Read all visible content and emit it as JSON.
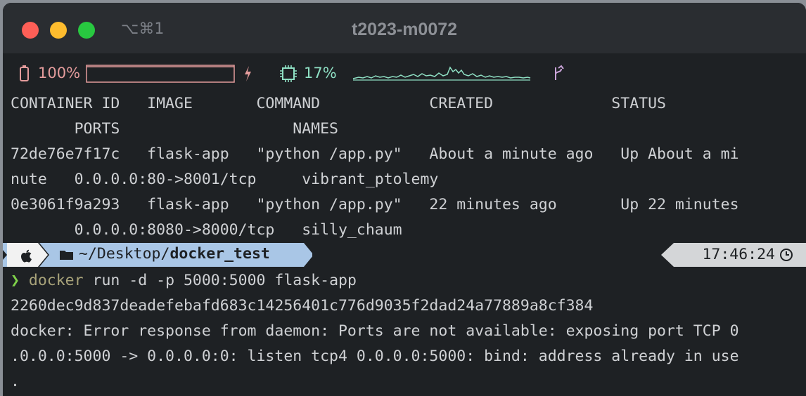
{
  "window": {
    "shortcut": "⌥⌘1",
    "title": "t2023-m0072"
  },
  "status_bar": {
    "battery_pct": "100%",
    "battery_level": 1.0,
    "cpu_pct": "17%"
  },
  "docker_ps": {
    "header_line1": "CONTAINER ID   IMAGE       COMMAND            CREATED             STATUS",
    "header_line2": "       PORTS                   NAMES",
    "rows": [
      "72de76e7f17c   flask-app   \"python /app.py\"   About a minute ago   Up About a mi",
      "nute   0.0.0.0:80->8001/tcp     vibrant_ptolemy",
      "0e3061f9a293   flask-app   \"python /app.py\"   22 minutes ago       Up 22 minutes",
      "       0.0.0.0:8080->8000/tcp   silly_chaum"
    ]
  },
  "prompt": {
    "path_prefix": "~/Desktop/",
    "path_dir": "docker_test",
    "time": "17:46:24",
    "symbol": "❯",
    "command_name": "docker",
    "command_args": " run -d -p 5000:5000 flask-app"
  },
  "output": {
    "container_hash": "2260dec9d837deadefebafd683c14256401c776d9035f2dad24a77889a8cf384",
    "error_lines": [
      "docker: Error response from daemon: Ports are not available: exposing port TCP 0",
      ".0.0.0:5000 -> 0.0.0.0:0: listen tcp4 0.0.0.0:5000: bind: address already in use",
      "."
    ]
  },
  "colors": {
    "segment_blue": "#a9c6e6",
    "time_segment": "#d4d6d8",
    "battery": "#e49c9c",
    "cpu": "#8fe0c4",
    "prompt_green": "#7fd14a"
  }
}
